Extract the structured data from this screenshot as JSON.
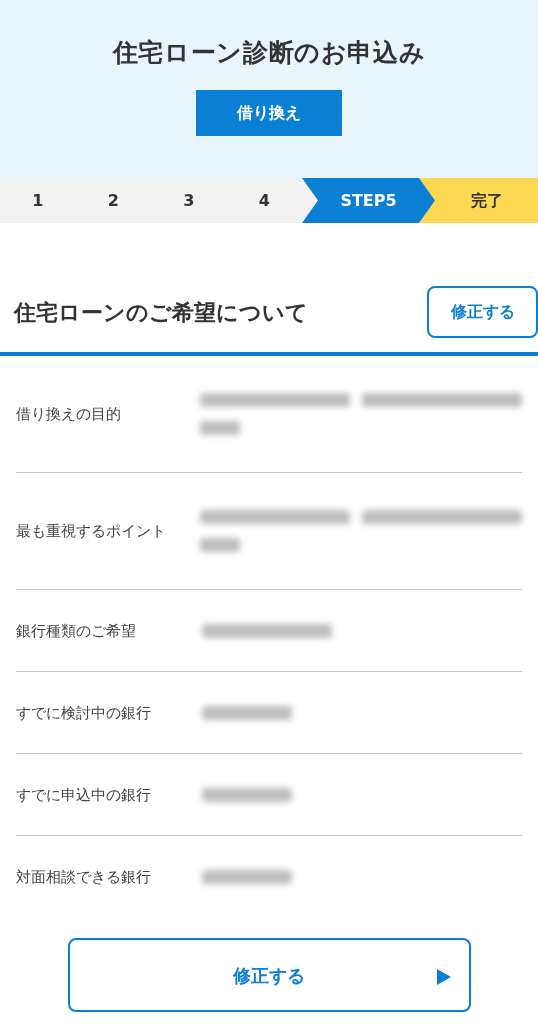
{
  "header": {
    "title": "住宅ローン診断のお申込み",
    "badge": "借り換え"
  },
  "steps": [
    {
      "label": "1",
      "kind": "number"
    },
    {
      "label": "2",
      "kind": "number"
    },
    {
      "label": "3",
      "kind": "number"
    },
    {
      "label": "4",
      "kind": "number"
    },
    {
      "label": "STEP5",
      "kind": "current"
    },
    {
      "label": "完了",
      "kind": "goal"
    }
  ],
  "section": {
    "title": "住宅ローンのご希望について",
    "edit_button": "修正する"
  },
  "rows": [
    {
      "label": "借り換えの目的",
      "kind": "long"
    },
    {
      "label": "最も重視するポイント",
      "kind": "long"
    },
    {
      "label": "銀行種類のご希望",
      "kind": "medium"
    },
    {
      "label": "すでに検討中の銀行",
      "kind": "short"
    },
    {
      "label": "すでに申込中の銀行",
      "kind": "short"
    },
    {
      "label": "対面相談できる銀行",
      "kind": "short"
    }
  ],
  "bottom_button": {
    "label": "修正する"
  }
}
